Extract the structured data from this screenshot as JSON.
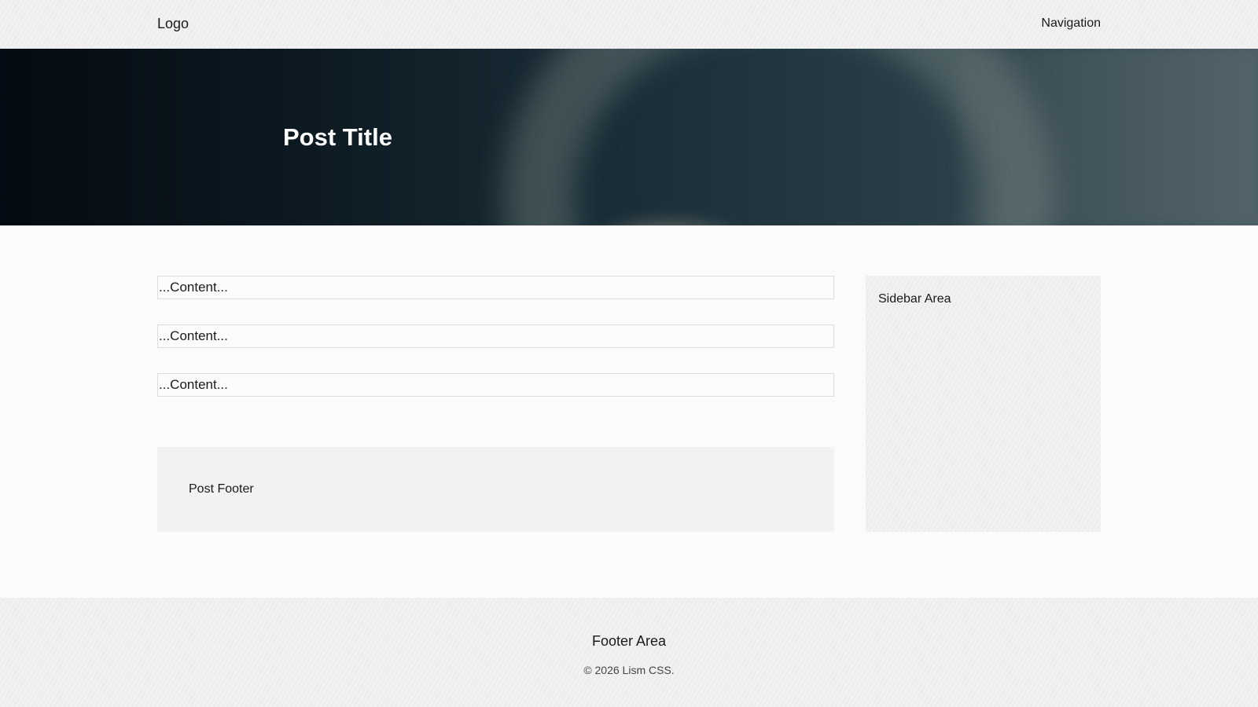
{
  "header": {
    "logo": "Logo",
    "navigation": "Navigation"
  },
  "hero": {
    "title": "Post Title"
  },
  "main": {
    "content_blocks": [
      {
        "text": "...Content..."
      },
      {
        "text": "...Content..."
      },
      {
        "text": "...Content..."
      }
    ],
    "post_footer": "Post Footer"
  },
  "sidebar": {
    "label": "Sidebar Area"
  },
  "footer": {
    "title": "Footer Area",
    "copyright": "© 2026 Lism CSS."
  }
}
